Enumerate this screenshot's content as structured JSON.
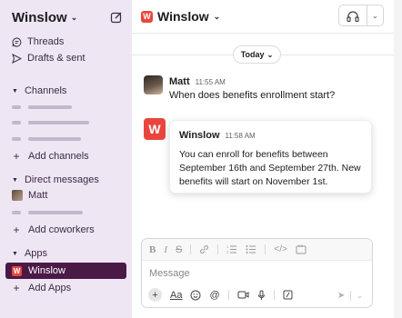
{
  "workspace": {
    "name": "Winslow",
    "chevron_icon": "chevron-down-icon",
    "compose_icon": "compose-icon"
  },
  "sidebar": {
    "nav": [
      {
        "label": "Threads",
        "icon": "threads-icon"
      },
      {
        "label": "Drafts & sent",
        "icon": "send-icon"
      }
    ],
    "channels_header": "Channels",
    "add_channels": "Add channels",
    "dm_header": "Direct messages",
    "dm_user": "Matt",
    "add_coworkers": "Add coworkers",
    "apps_header": "Apps",
    "active_app": "Winslow",
    "app_logo_letter": "W",
    "add_apps": "Add Apps"
  },
  "header": {
    "title": "Winslow",
    "logo_letter": "W"
  },
  "divider": {
    "label": "Today"
  },
  "messages": [
    {
      "author": "Matt",
      "time": "11:55 AM",
      "text": "When does benefits enrollment start?"
    },
    {
      "author": "Winslow",
      "time": "11:58 AM",
      "logo_letter": "W",
      "text": "You can enroll for benefits between September 16th and September 27th. New benefits will start on November 1st."
    }
  ],
  "composer": {
    "placeholder": "Message",
    "format_icons": [
      "bold-icon",
      "italic-icon",
      "strikethrough-icon",
      "link-icon",
      "ordered-list-icon",
      "bulleted-list-icon",
      "code-icon",
      "code-block-icon"
    ],
    "tool_icons": [
      "plus-icon",
      "text-format-icon",
      "emoji-icon",
      "mention-icon",
      "video-icon",
      "microphone-icon",
      "shortcuts-icon"
    ],
    "aa_label": "Aa"
  },
  "colors": {
    "sidebar_bg": "#efe6f4",
    "active_bg": "#4a1a47",
    "brand": "#e8463d"
  }
}
